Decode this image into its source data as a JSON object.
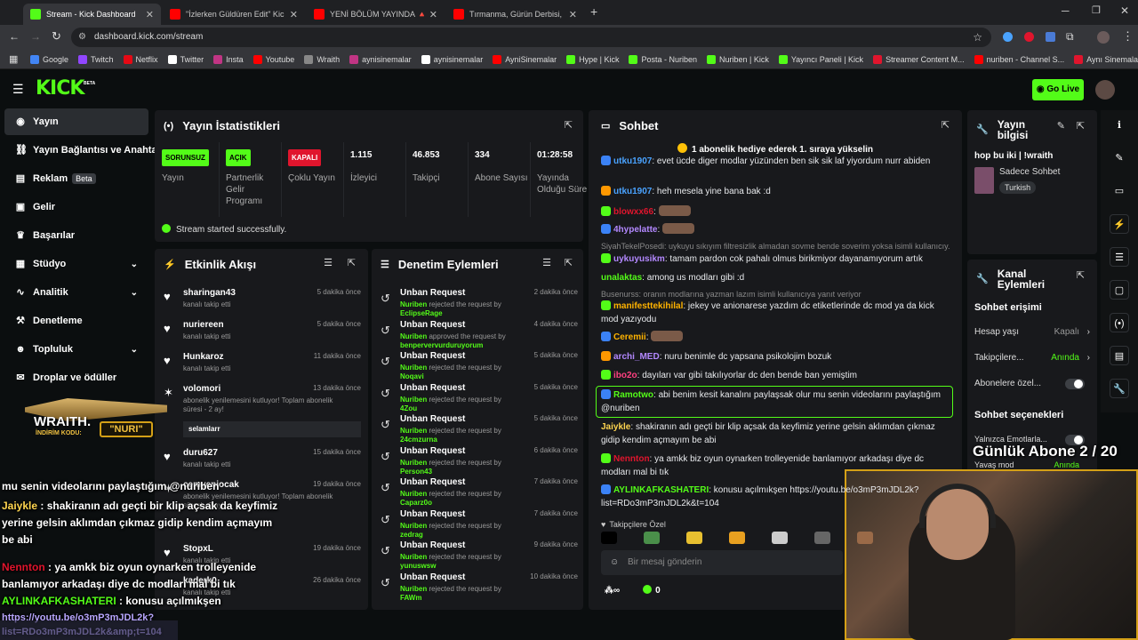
{
  "browser": {
    "tabs": [
      {
        "label": "Stream - Kick Dashboard",
        "color": "#53fc18"
      },
      {
        "label": "\"İzlerken Güldüren Edit\" Kick &",
        "color": "#ff0000"
      },
      {
        "label": "YENİ BÖLÜM YAYINDA 🔺 @O",
        "color": "#ff0000"
      },
      {
        "label": "Tırmanma, Gürün Derbisi, Yüks",
        "color": "#ff0000"
      }
    ],
    "url": "dashboard.kick.com/stream",
    "bookmarks": [
      "Google",
      "Twitch",
      "Netflix",
      "Twitter",
      "Insta",
      "Youtube",
      "Wraith",
      "aynisinemalar",
      "aynisinemalar",
      "AyniSinemalar",
      "Hype | Kick",
      "Posta - Nuriben",
      "Nuriben | Kick",
      "Yayıncı Paneli | Kick",
      "Streamer Content M...",
      "nuriben - Channel S...",
      "Aynı Sinemalar - Ça..."
    ]
  },
  "topnav": {
    "logo": "KICK",
    "beta": "BETA",
    "go_live": "Go Live"
  },
  "sidebar": {
    "items": [
      {
        "label": "Yayın",
        "icon": "broadcast-icon"
      },
      {
        "label": "Yayın Bağlantısı ve Anahtarı",
        "icon": "link-icon"
      },
      {
        "label": "Reklam",
        "badge": "Beta",
        "icon": "ad-icon"
      },
      {
        "label": "Gelir",
        "icon": "wallet-icon"
      },
      {
        "label": "Başarılar",
        "icon": "trophy-icon"
      },
      {
        "label": "Stüdyo",
        "icon": "studio-icon"
      },
      {
        "label": "Analitik",
        "icon": "chart-icon"
      },
      {
        "label": "Denetleme",
        "icon": "gavel-icon"
      },
      {
        "label": "Topluluk",
        "icon": "people-icon"
      },
      {
        "label": "Droplar ve ödüller",
        "icon": "gift-icon"
      }
    ]
  },
  "stats": {
    "title": "Yayın İstatistikleri",
    "items": [
      {
        "value": "SORUNSUZ",
        "label": "Yayın",
        "pill_color": "#53fc18"
      },
      {
        "value": "AÇIK",
        "label": "Partnerlik Gelir Programı",
        "pill_color": "#53fc18"
      },
      {
        "value": "KAPALI",
        "label": "Çoklu Yayın",
        "pill_color": "#e0152d"
      },
      {
        "value": "1.115",
        "label": "İzleyici"
      },
      {
        "value": "46.853",
        "label": "Takipçi"
      },
      {
        "value": "334",
        "label": "Abone Sayısı"
      },
      {
        "value": "01:28:58",
        "label": "Yayında Olduğu Süre"
      }
    ],
    "status_msg": "Stream started successfully."
  },
  "activity": {
    "title": "Etkinlik Akışı",
    "rows": [
      {
        "name": "sharingan43",
        "sub": "kanalı takip etti",
        "time": "5 dakika önce"
      },
      {
        "name": "nuriereen",
        "sub": "kanalı takip etti",
        "time": "5 dakika önce"
      },
      {
        "name": "Hunkaroz",
        "sub": "kanalı takip etti",
        "time": "11 dakika önce"
      },
      {
        "name": "volomori",
        "sub": "abonelik yenilemesini kutluyor! Toplam abonelik süresi - 2 ay!",
        "time": "13 dakika önce",
        "msg": "selamlarr"
      },
      {
        "name": "duru627",
        "sub": "kanalı takip etti",
        "time": "15 dakika önce"
      },
      {
        "name": "cemyeniocak",
        "sub": "abonelik yenilemesini kutluyor! Toplam abonelik süresi - 2 ay!",
        "time": "19 dakika önce"
      },
      {
        "name": "StopxL",
        "sub": "kanalı takip etti",
        "time": "19 dakika önce"
      },
      {
        "name": "kaderk0",
        "sub": "kanalı takip etti",
        "time": "26 dakika önce"
      }
    ]
  },
  "moderation": {
    "title": "Denetim Eylemleri",
    "rows": [
      {
        "title": "Unban Request",
        "by": "Nuriben",
        "action": "rejected the request by",
        "user": "EclipseRage",
        "time": "2 dakika önce"
      },
      {
        "title": "Unban Request",
        "by": "Nuriben",
        "action": "approved the request by",
        "user": "benpervervurduruyorum",
        "time": "4 dakika önce"
      },
      {
        "title": "Unban Request",
        "by": "Nuriben",
        "action": "rejected the request by",
        "user": "Noqavi",
        "time": "5 dakika önce"
      },
      {
        "title": "Unban Request",
        "by": "Nuriben",
        "action": "rejected the request by",
        "user": "4Zou",
        "time": "5 dakika önce"
      },
      {
        "title": "Unban Request",
        "by": "Nuriben",
        "action": "rejected the request by",
        "user": "24cmzurna",
        "time": "5 dakika önce"
      },
      {
        "title": "Unban Request",
        "by": "Nuriben",
        "action": "rejected the request by",
        "user": "Person43",
        "time": "6 dakika önce"
      },
      {
        "title": "Unban Request",
        "by": "Nuriben",
        "action": "rejected the request by",
        "user": "Caparz0o",
        "time": "7 dakika önce"
      },
      {
        "title": "Unban Request",
        "by": "Nuriben",
        "action": "rejected the request by",
        "user": "zedrag",
        "time": "7 dakika önce"
      },
      {
        "title": "Unban Request",
        "by": "Nuriben",
        "action": "rejected the request by",
        "user": "yunuswsw",
        "time": "9 dakika önce"
      },
      {
        "title": "Unban Request",
        "by": "Nuriben",
        "action": "rejected the request by",
        "user": "FAWm",
        "time": "10 dakika önce"
      }
    ]
  },
  "chat": {
    "title": "Sohbet",
    "pinned": "1 abonelik hediye ederek 1. sıraya yükselin",
    "lines": [
      {
        "user": "utku1907",
        "color": "#4aa3ff",
        "text": "evet ücde diger modlar yüzünden ben sik sik laf yiyordum nurr abiden"
      },
      {
        "user": "utku1907",
        "color": "#4aa3ff",
        "text": "heh mesela yine bana bak :d"
      },
      {
        "user": "blowxx66",
        "color": "#e0152d",
        "text": ""
      },
      {
        "user": "4hypelatte",
        "color": "#b388ff",
        "text": ""
      },
      {
        "reply": "SiyahTekelPosedi: uykuyu sıkıyım filtresizlik almadan sovme bende soverim yoksa isimli kullanıcıy..."
      },
      {
        "user": "uykuyusikm",
        "color": "#b388ff",
        "text": "tamam pardon cok pahalı olmus birikmiyor dayanamıyorum artık"
      },
      {
        "user": "unalaktas",
        "color": "#53fc18",
        "text": "among us modları gibi :d"
      },
      {
        "reply": "Busenurss: oranın modlarına yazman lazım isimli kullanıcıya yanıt veriyor"
      },
      {
        "user": "manifesttekihilal",
        "color": "#ffb300",
        "text": "jekey ve anionarese yazdım dc etiketlerinde dc mod ya da kick mod yazıyodu"
      },
      {
        "user": "Ceremii",
        "color": "#ffb300",
        "text": ""
      },
      {
        "user": "archi_MED",
        "color": "#b388ff",
        "text": "nuru benimle dc yapsana psikolojim bozuk"
      },
      {
        "user": "ibo2o",
        "color": "#ff4081",
        "text": "dayıları var gibi takılıyorlar dc den bende ban yemiştim"
      },
      {
        "user": "Ramotwo",
        "color": "#53fc18",
        "text": "abi benim kesit kanalını paylaşsak olur mu senin videolarını paylaştığım @nuriben"
      },
      {
        "user": "Jaiykle",
        "color": "#ffd54f",
        "text": "shakiranın adı geçti bir klip açsak da keyfimiz yerine gelsin aklımdan çıkmaz gidip kendim açmayım be abi"
      },
      {
        "user": "Nennton",
        "color": "#e0152d",
        "text": "ya amkk biz oyun oynarken trolleyenide banlamıyor arkadaşı diye dc modları mal bi tık"
      },
      {
        "user": "AYLINKAFKASHATERI",
        "color": "#53fc18",
        "text": "konusu açılmıkşen https://youtu.be/o3mP3mJDL2k?list=RDo3mP3mJDL2k&t=104"
      }
    ],
    "emote_section": "Takipçilere Özel",
    "input_placeholder": "Bir mesaj gönderin",
    "count": "0"
  },
  "stream_info": {
    "title": "Yayın bilgisi",
    "stream_title": "hop bu iki | !wraith",
    "category": "Sadece Sohbet",
    "tag": "Turkish"
  },
  "channel_actions": {
    "title": "Kanal Eylemleri",
    "chat_access": "Sohbet erişimi",
    "items": [
      {
        "label": "Hesap yaşı",
        "value": "Kapalı"
      },
      {
        "label": "Takipçilere...",
        "value": "Anında"
      },
      {
        "label": "Abonelere özel..."
      }
    ],
    "chat_options": "Sohbet seçenekleri",
    "options": [
      {
        "label": "Yalnızca Emotlarla..."
      },
      {
        "label": "Yavaş mod",
        "value": "Anında"
      }
    ]
  },
  "overlay": {
    "daily_sub": "Günlük Abone 2 / 20",
    "wraith_text": "WRAITH.",
    "code_label": "İNDİRİM KODU:",
    "code": "NURI",
    "chat": [
      {
        "text": "mu senin videolarını paylaştığım @nuriben"
      },
      {
        "user": "Jaiykle",
        "text": "shakiranın adı geçti bir klip açsak da keyfimiz yerine gelsin aklımdan çıkmaz gidip kendim açmayım be abi"
      },
      {
        "user": "Nennton",
        "text": "ya amkk biz oyun oynarken trolleyenide banlamıyor arkadaşı diye dc modları mal bi tık"
      },
      {
        "user": "AYLINKAFKASHATERI",
        "text": "konusu açılmıkşen"
      },
      {
        "text": "https://youtu.be/o3mP3mJDL2k?list=RDo3mP3mJDL2k&amp;t=104"
      }
    ]
  }
}
